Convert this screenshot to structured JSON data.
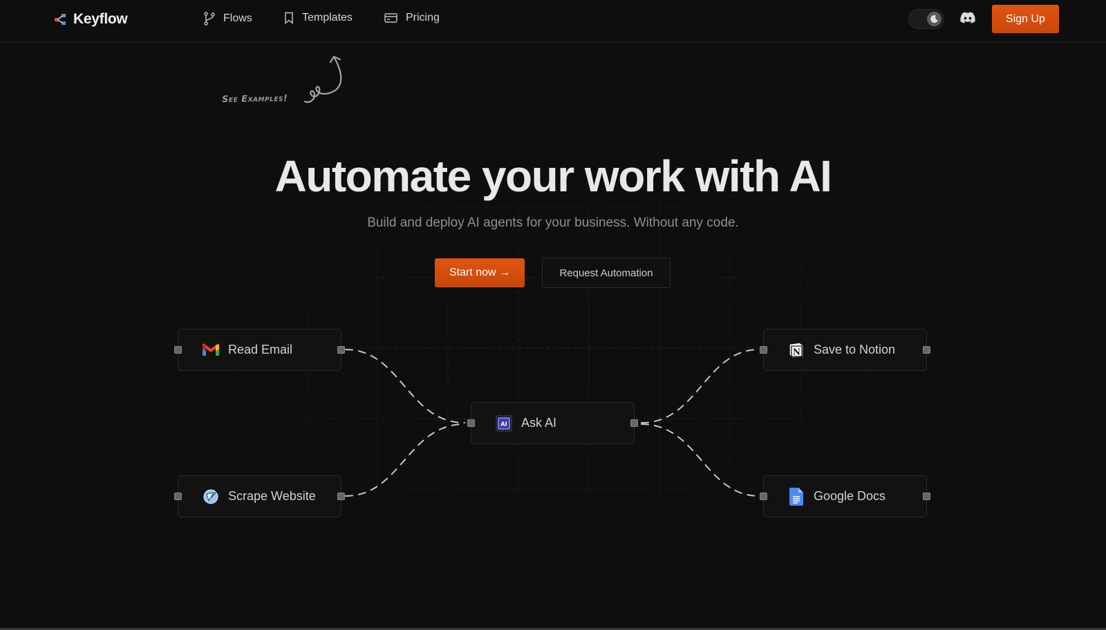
{
  "header": {
    "brand": "Keyflow",
    "nav": [
      {
        "label": "Flows",
        "icon": "git-branch-icon"
      },
      {
        "label": "Templates",
        "icon": "bookmark-icon"
      },
      {
        "label": "Pricing",
        "icon": "credit-card-icon"
      }
    ],
    "theme_toggle": {
      "icon": "moon-icon",
      "state": "dark"
    },
    "discord_icon": "discord-icon",
    "signup_label": "Sign Up"
  },
  "annotation": {
    "text": "See Examples!"
  },
  "hero": {
    "title": "Automate your work with AI",
    "subtitle": "Build and deploy AI agents for your business. Without any code.",
    "primary_cta": "Start now →",
    "secondary_cta": "Request Automation"
  },
  "flow": {
    "nodes": [
      {
        "id": "read-email",
        "label": "Read Email",
        "icon": "gmail-icon"
      },
      {
        "id": "scrape-website",
        "label": "Scrape Website",
        "icon": "scrape-icon"
      },
      {
        "id": "ask-ai",
        "label": "Ask AI",
        "icon": "ai-chip-icon"
      },
      {
        "id": "save-notion",
        "label": "Save to Notion",
        "icon": "notion-icon"
      },
      {
        "id": "google-docs",
        "label": "Google Docs",
        "icon": "google-docs-icon"
      }
    ],
    "edges": [
      [
        "read-email",
        "ask-ai"
      ],
      [
        "scrape-website",
        "ask-ai"
      ],
      [
        "ask-ai",
        "save-notion"
      ],
      [
        "ask-ai",
        "google-docs"
      ]
    ]
  },
  "colors": {
    "accent": "#e2540f",
    "background": "#0e0e0e",
    "node_border": "#2a2a2a"
  }
}
